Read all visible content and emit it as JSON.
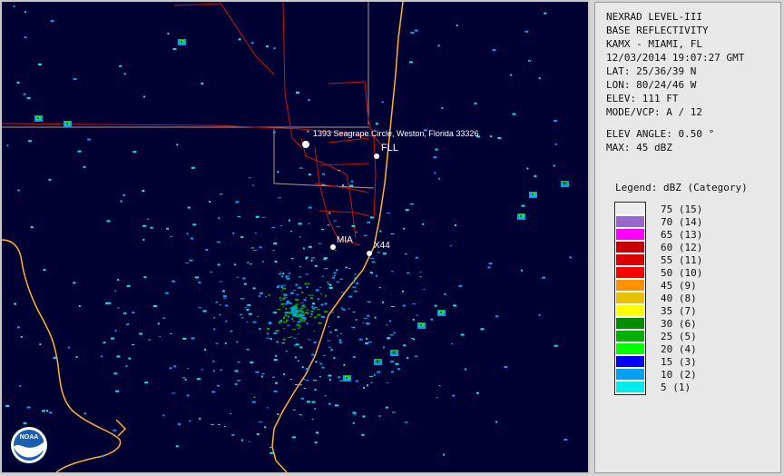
{
  "header_lines": [
    "NEXRAD LEVEL-III",
    "BASE REFLECTIVITY",
    "KAMX - MIAMI, FL",
    "12/03/2014 19:07:27 GMT",
    "LAT: 25/36/39 N",
    "LON: 80/24/46 W",
    "ELEV: 111 FT",
    "MODE/VCP: A / 12"
  ],
  "elev_angle": "ELEV ANGLE: 0.50 °",
  "max": "MAX: 45 dBZ",
  "legend": {
    "title": "Legend: dBZ (Category)",
    "items": [
      {
        "label": "75  (15)",
        "color": "#ececec"
      },
      {
        "label": "70  (14)",
        "color": "#9966cc"
      },
      {
        "label": "65  (13)",
        "color": "#ff00ff"
      },
      {
        "label": "60  (12)",
        "color": "#c80000"
      },
      {
        "label": "55  (11)",
        "color": "#dd0000"
      },
      {
        "label": "50  (10)",
        "color": "#ff0000"
      },
      {
        "label": "45  (9)",
        "color": "#ff9000"
      },
      {
        "label": "40  (8)",
        "color": "#e7c000"
      },
      {
        "label": "35  (7)",
        "color": "#ffff00"
      },
      {
        "label": "30  (6)",
        "color": "#008e00"
      },
      {
        "label": "25  (5)",
        "color": "#00b000"
      },
      {
        "label": "20  (4)",
        "color": "#00ff00"
      },
      {
        "label": "15  (3)",
        "color": "#0000f6"
      },
      {
        "label": "10  (2)",
        "color": "#01a0f6"
      },
      {
        "label": "5  (1)",
        "color": "#00ecec"
      }
    ]
  },
  "map": {
    "background": "#000033",
    "coast_color": "#ffb030",
    "road_color": "#c81414",
    "county_color": "#b49696",
    "markers": {
      "address": "1393 Seagrape Circle, Weston, Florida 33326",
      "fll": "FLL",
      "mia": "MIA",
      "x44": "X44"
    },
    "logo_text": "NOAA"
  }
}
